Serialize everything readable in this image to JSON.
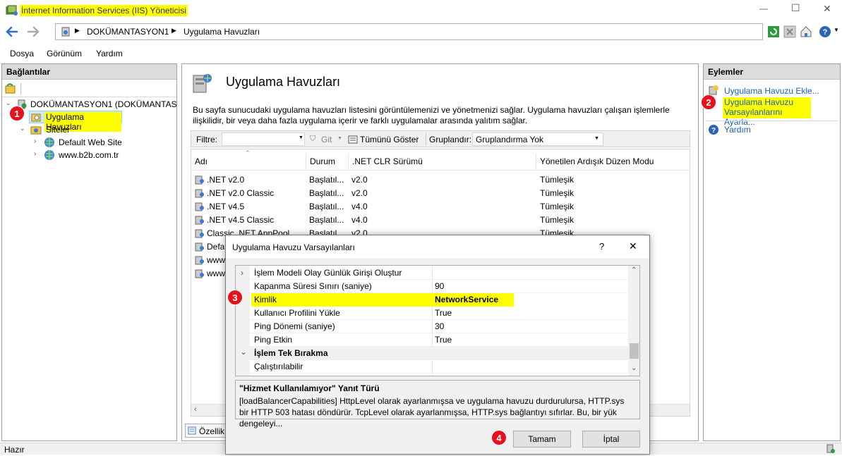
{
  "window": {
    "title": "İnternet Information Services (IIS) Yöneticisi",
    "minimize": "—",
    "maximize": "☐",
    "close": "✕"
  },
  "address": {
    "crumbs": [
      "DOKÜMANTASYON1",
      "Uygulama Havuzları"
    ]
  },
  "menu": [
    "Dosya",
    "Görünüm",
    "Yardım"
  ],
  "connections": {
    "title": "Bağlantılar",
    "tree": {
      "server": "DOKÜMANTASYON1 (DOKÜMANTASYON",
      "app_pools": "Uygulama Havuzları",
      "sites": "Siteler",
      "site1": "Default Web Site",
      "site2": "www.b2b.com.tr"
    }
  },
  "center": {
    "title": "Uygulama Havuzları",
    "description": "Bu sayfa sunucudaki uygulama havuzları listesini görüntülemenizi ve yönetmenizi sağlar. Uygulama havuzları çalışan işlemlerle ilişkilidir, bir veya daha fazla uygulama içerir ve farklı uygulamalar arasında yalıtım sağlar.",
    "filter_label": "Filtre:",
    "go_label": "Git",
    "show_all_label": "Tümünü Göster",
    "group_label": "Gruplandır:",
    "group_value": "Gruplandırma Yok",
    "columns": [
      "Adı",
      "Durum",
      ".NET CLR Sürümü",
      "Yönetilen Ardışık Düzen Modu"
    ],
    "rows": [
      {
        "name": ".NET v2.0",
        "status": "Başlatıl...",
        "clr": "v2.0",
        "mode": "Tümleşik"
      },
      {
        "name": ".NET v2.0 Classic",
        "status": "Başlatıl...",
        "clr": "v2.0",
        "mode": "Tümleşik"
      },
      {
        "name": ".NET v4.5",
        "status": "Başlatıl...",
        "clr": "v4.0",
        "mode": "Tümleşik"
      },
      {
        "name": ".NET v4.5 Classic",
        "status": "Başlatıl...",
        "clr": "v4.0",
        "mode": "Tümleşik"
      },
      {
        "name": "Classic .NET AppPool",
        "status": "Başlatıl...",
        "clr": "v2.0",
        "mode": "Tümleşik"
      },
      {
        "name": "Defa",
        "status": "",
        "clr": "",
        "mode": ""
      },
      {
        "name": "www",
        "status": "",
        "clr": "",
        "mode": ""
      },
      {
        "name": "www",
        "status": "",
        "clr": "",
        "mode": ""
      }
    ],
    "features_tab": "Özellik"
  },
  "actions": {
    "title": "Eylemler",
    "add": "Uygulama Havuzu Ekle...",
    "defaults_line1": "Uygulama Havuzu",
    "defaults_line2": "Varsayılanlarını Ayarla...",
    "help": "Yardım"
  },
  "status_bar": "Hazır",
  "dialog": {
    "title": "Uygulama Havuzu Varsayılanları",
    "help": "?",
    "close": "✕",
    "props": [
      {
        "name": "İşlem Modeli Olay Günlük Girişi Oluştur",
        "value": "",
        "type": "collapsed"
      },
      {
        "name": "Kapanma Süresi Sınırı (saniye)",
        "value": "90",
        "type": "prop"
      },
      {
        "name": "Kimlik",
        "value": "NetworkService",
        "type": "highlight"
      },
      {
        "name": "Kullanıcı Profilini Yükle",
        "value": "True",
        "type": "prop"
      },
      {
        "name": "Ping Dönemi (saniye)",
        "value": "30",
        "type": "prop"
      },
      {
        "name": "Ping Etkin",
        "value": "True",
        "type": "prop"
      },
      {
        "name": "İşlem Tek Bırakma",
        "value": "",
        "type": "category"
      },
      {
        "name": "Çalıştırılabilir",
        "value": "",
        "type": "prop"
      }
    ],
    "desc_title": "\"Hizmet Kullanılamıyor\" Yanıt Türü",
    "desc_text": "[loadBalancerCapabilities] HttpLevel olarak ayarlanmışsa ve uygulama havuzu durdurulursa, HTTP.sys bir HTTP 503 hatası döndürür. TcpLevel olarak ayarlanmışsa, HTTP.sys bağlantıyı sıfırlar. Bu, bir yük dengeleyi...",
    "ok": "Tamam",
    "cancel": "İptal"
  },
  "badges": [
    "1",
    "2",
    "3",
    "4"
  ],
  "colors": {
    "highlight": "#ffff00",
    "badge": "#e8101a",
    "link": "#1a5fb4",
    "selection": "#cce8ff"
  }
}
